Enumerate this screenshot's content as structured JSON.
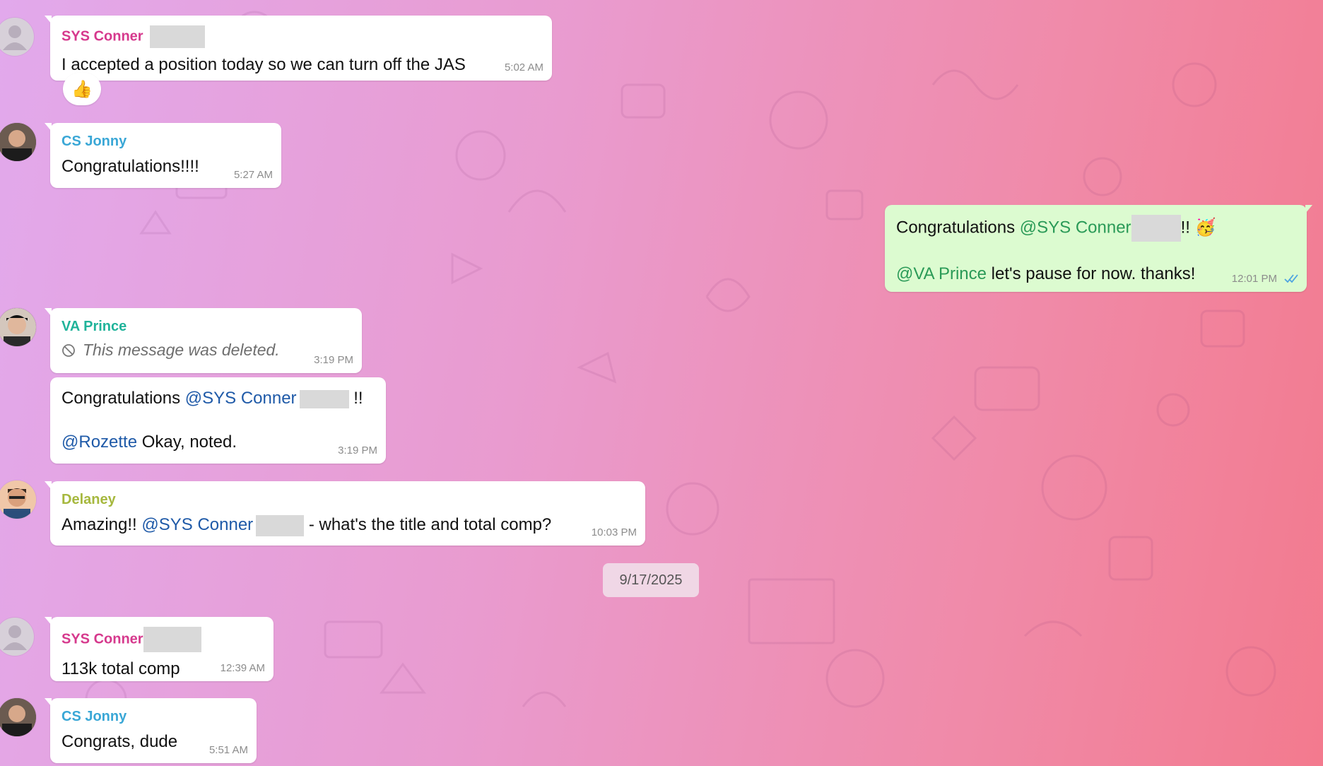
{
  "messages": [
    {
      "sender": "SYS Conner",
      "sender_color": "#d6398d",
      "text": "I accepted a position today so we can turn off the JAS",
      "time": "5:02 AM",
      "reaction": "👍"
    },
    {
      "sender": "CS Jonny",
      "sender_color": "#3aa7d6",
      "text": "Congratulations!!!!",
      "time": "5:27 AM"
    },
    {
      "outgoing": true,
      "line1_prefix": "Congratulations ",
      "line1_mention": "@SYS Conner",
      "line1_suffix": "!! 🥳",
      "line2_mention": "@VA Prince",
      "line2_text": " let's pause for now. thanks!",
      "time": "12:01 PM",
      "status_icon": "double-check-icon"
    },
    {
      "sender": "VA Prince",
      "sender_color": "#20b39a",
      "deleted_text": "This message was deleted.",
      "time": "3:19 PM"
    },
    {
      "line1_prefix": "Congratulations ",
      "line1_mention": "@SYS Conner",
      "line1_suffix": " !!",
      "line2_mention": "@Rozette",
      "line2_text": " Okay, noted.",
      "time": "3:19 PM"
    },
    {
      "sender": "Delaney",
      "sender_color": "#a6b83e",
      "text_prefix": "Amazing!! ",
      "mention": "@SYS Conner",
      "text_suffix": " - what's the title and total comp?",
      "time": "10:03 PM"
    },
    {
      "sender": "SYS Conner",
      "sender_color": "#d6398d",
      "text": "113k total comp",
      "time": "12:39 AM"
    },
    {
      "sender": "CS Jonny",
      "sender_color": "#3aa7d6",
      "text": "Congrats, dude",
      "time": "5:51 AM"
    }
  ],
  "date_separator": "9/17/2025",
  "colors": {
    "outgoing_bubble": "#dcfbd0",
    "incoming_bubble": "#ffffff",
    "mention": "#1f5aa8",
    "outgoing_mention": "#2a9a57",
    "read_check": "#4ea4e0"
  },
  "avatars": [
    "default-user-icon",
    "jonny-avatar",
    "prince-avatar",
    "delaney-avatar",
    "default-user-icon",
    "jonny-avatar"
  ]
}
